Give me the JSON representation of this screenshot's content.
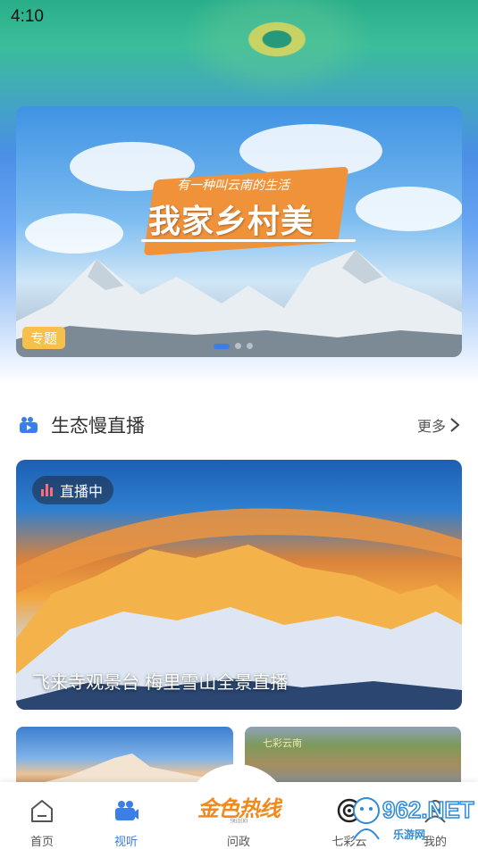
{
  "status_bar": {
    "time": "4:10"
  },
  "banner": {
    "subtitle": "有一种叫云南的生活",
    "title": "我家乡村美",
    "tag": "专题",
    "slide_count": 3,
    "active_slide": 1
  },
  "section": {
    "title": "生态慢直播",
    "more_label": "更多"
  },
  "live_card": {
    "badge": "直播中",
    "caption": "飞来寺观景台 梅里雪山全景直播"
  },
  "thumbnails": {
    "right_label": "七彩云南"
  },
  "tabbar": {
    "items": [
      {
        "label": "首页",
        "icon": "home-icon"
      },
      {
        "label": "视听",
        "icon": "camera-icon",
        "active": true
      },
      {
        "label": "问政",
        "icon": "logo-icon"
      },
      {
        "label": "七彩云",
        "icon": "target-icon"
      },
      {
        "label": "我的",
        "icon": "user-icon"
      }
    ],
    "center_logo": "金色热线",
    "center_logo_sub": "96100"
  },
  "watermark": {
    "text": "962.NET",
    "sub": "乐游网"
  },
  "colors": {
    "accent": "#3a7fe8",
    "tag": "#f6c04a",
    "logo": "#f08a1c",
    "live_dot": "#ff6a7a"
  }
}
